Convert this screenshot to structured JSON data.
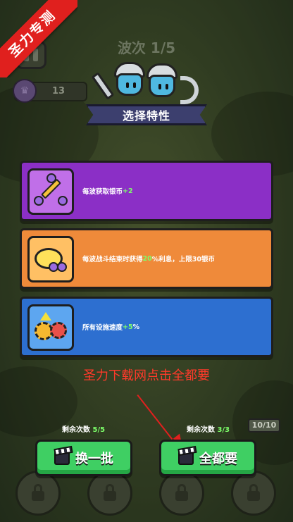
{
  "corner_ribbon": "圣力专测",
  "hud": {
    "wave_label": "波次 1/5",
    "coin_count": "13",
    "castle_hp": "10/10"
  },
  "dialog": {
    "title": "选择特性",
    "cards": [
      {
        "icon": "sword-coin-icon",
        "text_before": "每波获取银币",
        "highlight": "+2",
        "text_after": ""
      },
      {
        "icon": "piggy-bank-icon",
        "text_before": "每波战斗结束时获得 ",
        "highlight": "20",
        "text_after": "%利息，上限30银币"
      },
      {
        "icon": "gears-speed-icon",
        "text_before": "所有设施速度",
        "highlight": "+5",
        "text_after": "%"
      }
    ]
  },
  "promo_text": "圣力下载网点击全都要",
  "actions": {
    "refresh": {
      "counter_label": "剩余次数",
      "counter_value": "5/5",
      "button_label": "换一批"
    },
    "take_all": {
      "counter_label": "剩余次数",
      "counter_value": "3/3",
      "button_label": "全都要"
    }
  },
  "colors": {
    "card_purple": "#8b2fc6",
    "card_orange": "#ef8a3a",
    "card_blue": "#2d6fd0",
    "button_green": "#3fcf63",
    "highlight_green": "#7dff6a",
    "promo_red": "#ff3a2a"
  }
}
